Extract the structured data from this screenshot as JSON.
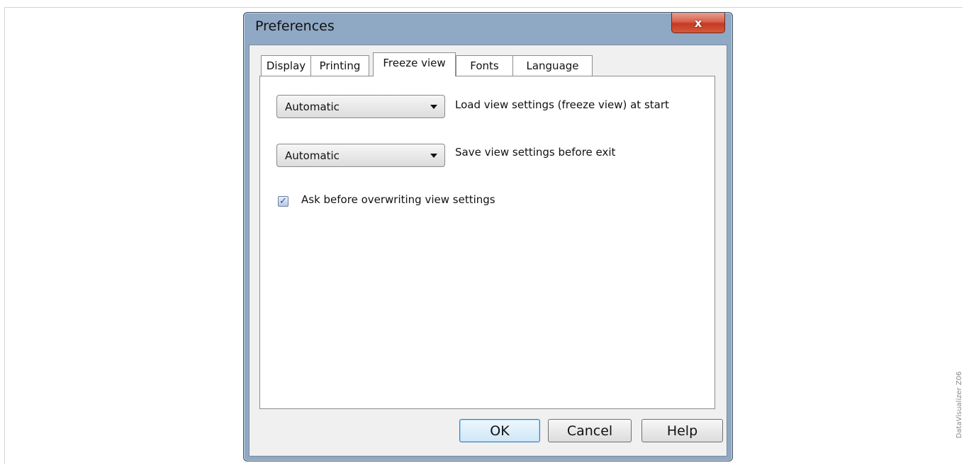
{
  "dialog": {
    "title": "Preferences",
    "close_glyph": "x"
  },
  "tabs": [
    {
      "label": "Display",
      "active": false
    },
    {
      "label": "Printing",
      "active": false
    },
    {
      "label": "Freeze view",
      "active": true
    },
    {
      "label": "Fonts",
      "active": false
    },
    {
      "label": "Language",
      "active": false
    }
  ],
  "freeze_view": {
    "load_setting": {
      "value": "Automatic",
      "label": "Load view settings (freeze view) at start"
    },
    "save_setting": {
      "value": "Automatic",
      "label": "Save view settings before exit"
    },
    "ask_overwrite": {
      "checked": true,
      "label": "Ask before overwriting view settings"
    }
  },
  "buttons": {
    "ok": "OK",
    "cancel": "Cancel",
    "help": "Help"
  },
  "side_caption": "DataVisualizer Z06",
  "icons": {
    "close": "close-icon",
    "dropdown": "chevron-down-icon",
    "check": "checkmark-icon"
  }
}
